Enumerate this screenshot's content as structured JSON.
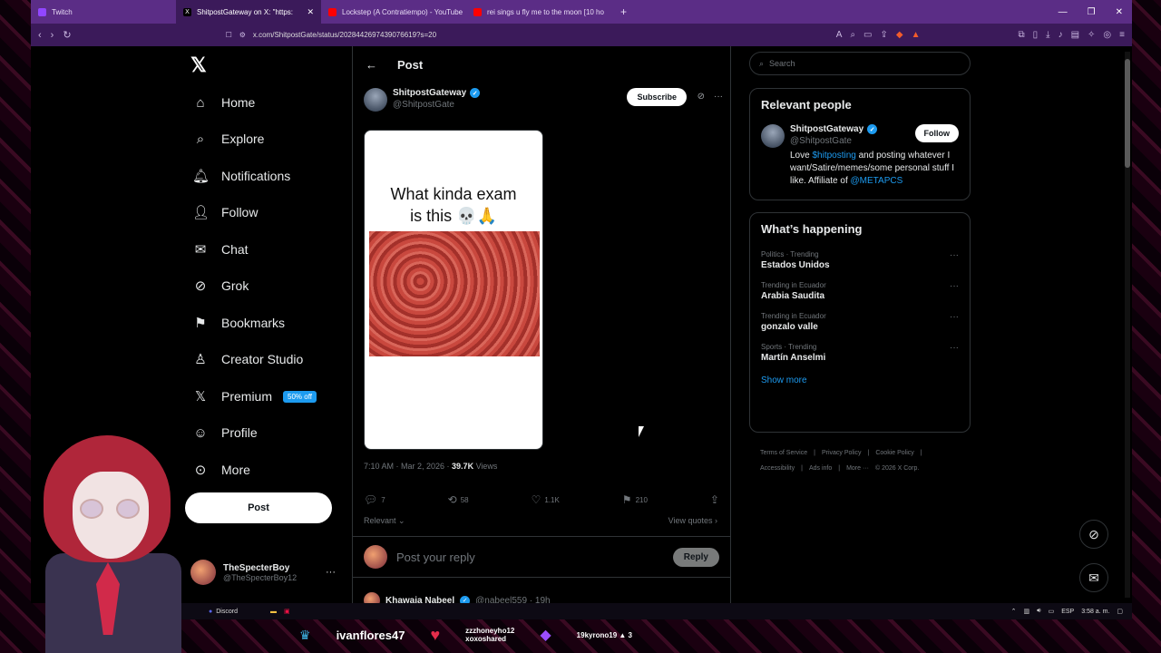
{
  "browser": {
    "tabs": [
      {
        "label": "Twitch",
        "color": "#9146ff",
        "active": false
      },
      {
        "label": "ShitpostGateway on X: \"https:",
        "color": "#000000",
        "active": true
      },
      {
        "label": "Lockstep (A Contratiempo) - YouTube",
        "color": "#ff0000",
        "active": false
      },
      {
        "label": "rei sings u fly me to the moon [10 ho",
        "color": "#ff0000",
        "active": false
      }
    ],
    "url": "x.com/ShitpostGate/status/2028442697439076619?s=20"
  },
  "nav": {
    "items": [
      {
        "label": "Home",
        "icon": "home-icon"
      },
      {
        "label": "Explore",
        "icon": "search-icon"
      },
      {
        "label": "Notifications",
        "icon": "bell-icon"
      },
      {
        "label": "Follow",
        "icon": "add-person-icon"
      },
      {
        "label": "Chat",
        "icon": "mail-icon"
      },
      {
        "label": "Grok",
        "icon": "grok-icon"
      },
      {
        "label": "Bookmarks",
        "icon": "bookmark-icon"
      },
      {
        "label": "Creator Studio",
        "icon": "creator-icon"
      },
      {
        "label": "Premium",
        "icon": "x-logo-icon"
      },
      {
        "label": "Profile",
        "icon": "person-icon"
      },
      {
        "label": "More",
        "icon": "more-circle-icon"
      }
    ],
    "premium_badge": "50% off",
    "post_button": "Post",
    "account": {
      "name": "TheSpecterBoy",
      "handle": "@TheSpecterBoy12"
    }
  },
  "post": {
    "header_title": "Post",
    "author_name": "ShitpostGateway",
    "author_handle": "@ShitpostGate",
    "subscribe_label": "Subscribe",
    "media_caption_line1": "What kinda exam",
    "media_caption_line2": "is this 💀🙏",
    "time": "7:10 AM · Mar 2, 2026 · ",
    "views_count": "39.7K",
    "views_label": " Views",
    "replies": "7",
    "reposts": "58",
    "likes": "1.1K",
    "bookmarks": "210",
    "sort_label": "Relevant ⌄",
    "view_quotes": "View quotes ›",
    "reply_placeholder": "Post your reply",
    "reply_button": "Reply",
    "next_reply_name": "Khawaja Nabeel",
    "next_reply_handle": "@nabeel559 · 19h"
  },
  "sidebar": {
    "search_placeholder": "Search",
    "relevant_title": "Relevant people",
    "person_name": "ShitpostGateway",
    "person_handle": "@ShitpostGate",
    "follow_label": "Follow",
    "bio_pre": "Love ",
    "bio_link1": "$hitposting",
    "bio_mid": " and posting whatever I want/Satire/memes/some personal stuff I like. Affiliate of ",
    "bio_link2": "@METAPCS",
    "happening_title": "What’s happening",
    "trends": [
      {
        "meta": "Politics · Trending",
        "name": "Estados Unidos"
      },
      {
        "meta": "Trending in Ecuador",
        "name": "Arabia Saudita"
      },
      {
        "meta": "Trending in Ecuador",
        "name": "gonzalo valle"
      },
      {
        "meta": "Sports · Trending",
        "name": "Martín Anselmi"
      }
    ],
    "show_more": "Show more",
    "footer": [
      "Terms of Service",
      "|",
      "Privacy Policy",
      "|",
      "Cookie Policy",
      "|",
      "Accessibility",
      "|",
      "Ads info",
      "|",
      "More ···",
      "© 2026 X Corp."
    ]
  },
  "taskbar": {
    "discord": "Discord",
    "lang": "ESP",
    "time": "3:58 a. m."
  },
  "overlay": {
    "viewer": "ivanflores47",
    "heart_line1": "zzzhoneyho12",
    "heart_line2": "xoxoshared",
    "gem_label": "19kyrono19",
    "gem_count": "3"
  }
}
